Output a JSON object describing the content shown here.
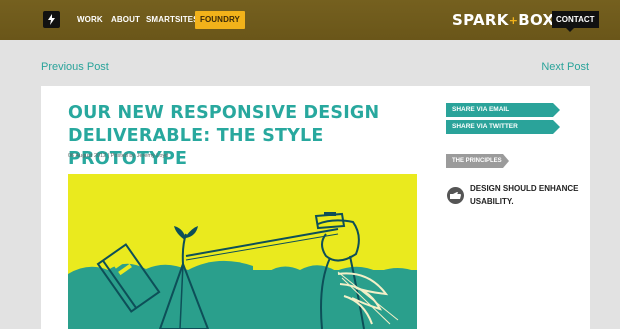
{
  "header": {
    "nav": {
      "work": "WORK",
      "about": "ABOUT",
      "smartsites": "SMARTSITES",
      "foundry": "FOUNDRY"
    },
    "logo_left": "SPARK",
    "logo_plus": "+",
    "logo_right": "BOX",
    "contact": "CONTACT"
  },
  "post_nav": {
    "previous": "Previous Post",
    "next": "Next Post"
  },
  "article": {
    "title": "OUR NEW RESPONSIVE DESIGN DELIVERABLE: THE STYLE PROTOTYPE",
    "meta": "06 August 2012 | Posted by Jeremy Loyd"
  },
  "sidebar": {
    "share_email": "SHARE VIA EMAIL",
    "share_twitter": "SHARE VIA TWITTER",
    "principles": "THE PRINCIPLES",
    "principle_text": "DESIGN SHOULD ENHANCE USABILITY."
  },
  "colors": {
    "nav_bg": "#6e5a1c",
    "accent_teal": "#2aa39a",
    "foundry_yellow": "#f2b21a",
    "hero_yellow": "#eaea1e",
    "hero_teal": "#2a9f8c"
  },
  "icons": [
    "bolt-icon",
    "hand-icon"
  ]
}
